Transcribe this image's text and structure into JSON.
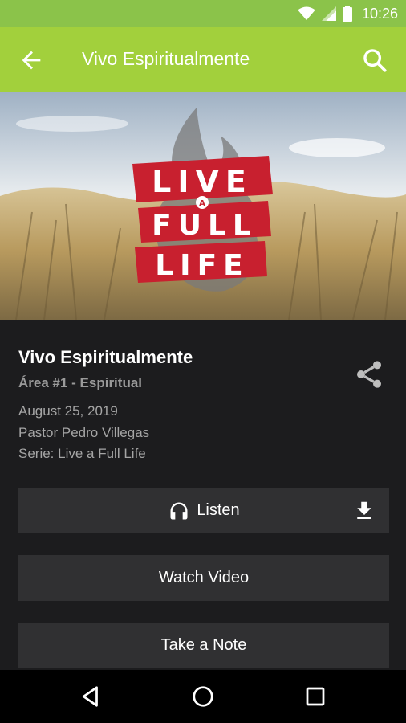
{
  "status_bar": {
    "time": "10:26"
  },
  "app_bar": {
    "title": "Vivo Espiritualmente"
  },
  "hero": {
    "artwork_lines": [
      "LIVE",
      "A",
      "FULL",
      "LIFE"
    ]
  },
  "sermon": {
    "title": "Vivo Espiritualmente",
    "area": "Área #1 - Espiritual",
    "date": "August 25, 2019",
    "speaker": "Pastor Pedro Villegas",
    "series": "Serie: Live a Full Life"
  },
  "actions": {
    "listen_label": "Listen",
    "watch_label": "Watch Video",
    "note_label": "Take a Note"
  },
  "colors": {
    "status_bar": "#8bc34a",
    "app_bar": "#a2d03c",
    "background": "#1c1c1e",
    "button": "#303032",
    "banner_red": "#c8202f"
  },
  "icons": [
    "wifi-icon",
    "signal-icon",
    "battery-icon",
    "back-arrow-icon",
    "search-icon",
    "share-icon",
    "headphones-icon",
    "download-icon",
    "nav-back-icon",
    "nav-home-icon",
    "nav-recents-icon"
  ]
}
